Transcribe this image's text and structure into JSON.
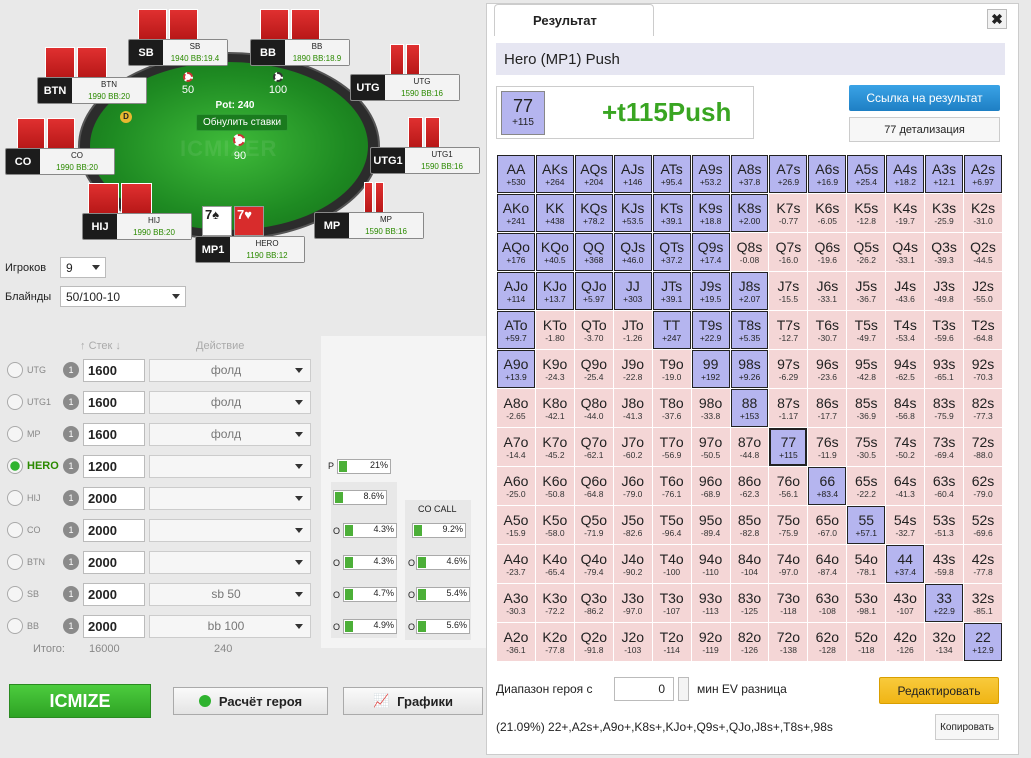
{
  "table": {
    "pot_label": "Pot: 240",
    "reset_label": "Обнулить ставки",
    "watermark": "ICMIZER",
    "bet_sb": "50",
    "bet_bb": "100",
    "hero_bet": "90",
    "seats": [
      {
        "pos": "SB",
        "name": "SB",
        "stack": "1940",
        "bb": "19.4"
      },
      {
        "pos": "BB",
        "name": "BB",
        "stack": "1890",
        "bb": "18.9"
      },
      {
        "pos": "UTG",
        "name": "UTG",
        "stack": "1590",
        "bb": "16"
      },
      {
        "pos": "UTG1",
        "name": "UTG1",
        "stack": "1590",
        "bb": "16"
      },
      {
        "pos": "MP",
        "name": "MP",
        "stack": "1590",
        "bb": "16"
      },
      {
        "pos": "MP1",
        "name": "HERO",
        "stack": "1190",
        "bb": "12"
      },
      {
        "pos": "HIJ",
        "name": "HIJ",
        "stack": "1990",
        "bb": "20"
      },
      {
        "pos": "CO",
        "name": "CO",
        "stack": "1990",
        "bb": "20"
      },
      {
        "pos": "BTN",
        "name": "BTN",
        "stack": "1990",
        "bb": "20"
      }
    ],
    "hero_cards": [
      "7♠",
      "7♥"
    ],
    "bb_suffix": "BB:",
    "dealer": "D"
  },
  "settings": {
    "players_label": "Игроков",
    "players_value": "9",
    "blinds_label": "Блайнды",
    "blinds_value": "50/100-10"
  },
  "players_table": {
    "stack_header": "Стек",
    "action_header": "Действие",
    "total_label": "Итого:",
    "total_stack": "16000",
    "total_action": "240",
    "rows": [
      {
        "name": "UTG",
        "stack": "1600",
        "action": "фолд",
        "on": false
      },
      {
        "name": "UTG1",
        "stack": "1600",
        "action": "фолд",
        "on": false
      },
      {
        "name": "MP",
        "stack": "1600",
        "action": "фолд",
        "on": false
      },
      {
        "name": "HERO",
        "stack": "1200",
        "action": "",
        "on": true
      },
      {
        "name": "HIJ",
        "stack": "2000",
        "action": "",
        "on": false
      },
      {
        "name": "CO",
        "stack": "2000",
        "action": "",
        "on": false
      },
      {
        "name": "BTN",
        "stack": "2000",
        "action": "",
        "on": false
      },
      {
        "name": "SB",
        "stack": "2000",
        "action": "sb 50",
        "on": false
      },
      {
        "name": "BB",
        "stack": "2000",
        "action": "bb 100",
        "on": false
      }
    ],
    "badge": "1"
  },
  "mini": {
    "p_label": "P",
    "p_value": "21%",
    "col1": [
      "8.6%",
      "4.3%",
      "4.3%",
      "4.7%",
      "4.9%"
    ],
    "col1_label": "O",
    "col2_header": "CO CALL",
    "col2": [
      "9.2%",
      "4.6%",
      "5.4%",
      "5.6%"
    ],
    "col2_label": "O"
  },
  "buttons": {
    "icmize": "ICMIZE",
    "hero_calc": "Расчёт героя",
    "graphs": "Графики"
  },
  "result": {
    "tab_title": "Результат",
    "close": "✖",
    "header": "Hero (MP1) Push",
    "hand": "77",
    "hand_ev": "+115",
    "ev_text": "+t115Push",
    "link_btn": "Ссылка на результат",
    "detail_btn": "77 детализация",
    "range_label": "Диапазон героя с",
    "range_value": "0",
    "min_ev_label": "мин EV разница",
    "edit_btn": "Редактировать",
    "summary": "(21.09%) 22+,A2s+,A9o+,K8s+,KJo+,Q9s+,QJo,J8s+,T8s+,98s",
    "copy_btn": "Копировать"
  },
  "chart_data": {
    "type": "table",
    "rows": [
      [
        [
          "AA",
          "+530",
          1
        ],
        [
          "AKs",
          "+264",
          1
        ],
        [
          "AQs",
          "+204",
          1
        ],
        [
          "AJs",
          "+146",
          1
        ],
        [
          "ATs",
          "+95.4",
          1
        ],
        [
          "A9s",
          "+53.2",
          1
        ],
        [
          "A8s",
          "+37.8",
          1
        ],
        [
          "A7s",
          "+26.9",
          1
        ],
        [
          "A6s",
          "+16.9",
          1
        ],
        [
          "A5s",
          "+25.4",
          1
        ],
        [
          "A4s",
          "+18.2",
          1
        ],
        [
          "A3s",
          "+12.1",
          1
        ],
        [
          "A2s",
          "+6.97",
          1
        ]
      ],
      [
        [
          "AKo",
          "+241",
          1
        ],
        [
          "KK",
          "+438",
          1
        ],
        [
          "KQs",
          "+78.2",
          1
        ],
        [
          "KJs",
          "+53.5",
          1
        ],
        [
          "KTs",
          "+39.1",
          1
        ],
        [
          "K9s",
          "+18.8",
          1
        ],
        [
          "K8s",
          "+2.00",
          1
        ],
        [
          "K7s",
          "-0.77",
          0
        ],
        [
          "K6s",
          "-6.05",
          0
        ],
        [
          "K5s",
          "-12.8",
          0
        ],
        [
          "K4s",
          "-19.7",
          0
        ],
        [
          "K3s",
          "-25.9",
          0
        ],
        [
          "K2s",
          "-31.0",
          0
        ]
      ],
      [
        [
          "AQo",
          "+176",
          1
        ],
        [
          "KQo",
          "+40.5",
          1
        ],
        [
          "QQ",
          "+368",
          1
        ],
        [
          "QJs",
          "+46.0",
          1
        ],
        [
          "QTs",
          "+37.2",
          1
        ],
        [
          "Q9s",
          "+17.4",
          1
        ],
        [
          "Q8s",
          "-0.08",
          0
        ],
        [
          "Q7s",
          "-16.0",
          0
        ],
        [
          "Q6s",
          "-19.6",
          0
        ],
        [
          "Q5s",
          "-26.2",
          0
        ],
        [
          "Q4s",
          "-33.1",
          0
        ],
        [
          "Q3s",
          "-39.3",
          0
        ],
        [
          "Q2s",
          "-44.5",
          0
        ]
      ],
      [
        [
          "AJo",
          "+114",
          1
        ],
        [
          "KJo",
          "+13.7",
          1
        ],
        [
          "QJo",
          "+5.97",
          1
        ],
        [
          "JJ",
          "+303",
          1
        ],
        [
          "JTs",
          "+39.1",
          1
        ],
        [
          "J9s",
          "+19.5",
          1
        ],
        [
          "J8s",
          "+2.07",
          1
        ],
        [
          "J7s",
          "-15.5",
          0
        ],
        [
          "J6s",
          "-33.1",
          0
        ],
        [
          "J5s",
          "-36.7",
          0
        ],
        [
          "J4s",
          "-43.6",
          0
        ],
        [
          "J3s",
          "-49.8",
          0
        ],
        [
          "J2s",
          "-55.0",
          0
        ]
      ],
      [
        [
          "ATo",
          "+59.7",
          1
        ],
        [
          "KTo",
          "-1.80",
          0
        ],
        [
          "QTo",
          "-3.70",
          0
        ],
        [
          "JTo",
          "-1.26",
          0
        ],
        [
          "TT",
          "+247",
          1
        ],
        [
          "T9s",
          "+22.9",
          1
        ],
        [
          "T8s",
          "+5.35",
          1
        ],
        [
          "T7s",
          "-12.7",
          0
        ],
        [
          "T6s",
          "-30.7",
          0
        ],
        [
          "T5s",
          "-49.7",
          0
        ],
        [
          "T4s",
          "-53.4",
          0
        ],
        [
          "T3s",
          "-59.6",
          0
        ],
        [
          "T2s",
          "-64.8",
          0
        ]
      ],
      [
        [
          "A9o",
          "+13.9",
          1
        ],
        [
          "K9o",
          "-24.3",
          0
        ],
        [
          "Q9o",
          "-25.4",
          0
        ],
        [
          "J9o",
          "-22.8",
          0
        ],
        [
          "T9o",
          "-19.0",
          0
        ],
        [
          "99",
          "+192",
          1
        ],
        [
          "98s",
          "+9.26",
          1
        ],
        [
          "97s",
          "-6.29",
          0
        ],
        [
          "96s",
          "-23.6",
          0
        ],
        [
          "95s",
          "-42.8",
          0
        ],
        [
          "94s",
          "-62.5",
          0
        ],
        [
          "93s",
          "-65.1",
          0
        ],
        [
          "92s",
          "-70.3",
          0
        ]
      ],
      [
        [
          "A8o",
          "-2.65",
          0
        ],
        [
          "K8o",
          "-42.1",
          0
        ],
        [
          "Q8o",
          "-44.0",
          0
        ],
        [
          "J8o",
          "-41.3",
          0
        ],
        [
          "T8o",
          "-37.6",
          0
        ],
        [
          "98o",
          "-33.8",
          0
        ],
        [
          "88",
          "+153",
          1
        ],
        [
          "87s",
          "-1.17",
          0
        ],
        [
          "86s",
          "-17.7",
          0
        ],
        [
          "85s",
          "-36.9",
          0
        ],
        [
          "84s",
          "-56.8",
          0
        ],
        [
          "83s",
          "-75.9",
          0
        ],
        [
          "82s",
          "-77.3",
          0
        ]
      ],
      [
        [
          "A7o",
          "-14.4",
          0
        ],
        [
          "K7o",
          "-45.2",
          0
        ],
        [
          "Q7o",
          "-62.1",
          0
        ],
        [
          "J7o",
          "-60.2",
          0
        ],
        [
          "T7o",
          "-56.9",
          0
        ],
        [
          "97o",
          "-50.5",
          0
        ],
        [
          "87o",
          "-44.8",
          0
        ],
        [
          "77",
          "+115",
          2
        ],
        [
          "76s",
          "-11.9",
          0
        ],
        [
          "75s",
          "-30.5",
          0
        ],
        [
          "74s",
          "-50.2",
          0
        ],
        [
          "73s",
          "-69.4",
          0
        ],
        [
          "72s",
          "-88.0",
          0
        ]
      ],
      [
        [
          "A6o",
          "-25.0",
          0
        ],
        [
          "K6o",
          "-50.8",
          0
        ],
        [
          "Q6o",
          "-64.8",
          0
        ],
        [
          "J6o",
          "-79.0",
          0
        ],
        [
          "T6o",
          "-76.1",
          0
        ],
        [
          "96o",
          "-68.9",
          0
        ],
        [
          "86o",
          "-62.3",
          0
        ],
        [
          "76o",
          "-56.1",
          0
        ],
        [
          "66",
          "+83.4",
          1
        ],
        [
          "65s",
          "-22.2",
          0
        ],
        [
          "64s",
          "-41.3",
          0
        ],
        [
          "63s",
          "-60.4",
          0
        ],
        [
          "62s",
          "-79.0",
          0
        ]
      ],
      [
        [
          "A5o",
          "-15.9",
          0
        ],
        [
          "K5o",
          "-58.0",
          0
        ],
        [
          "Q5o",
          "-71.9",
          0
        ],
        [
          "J5o",
          "-82.6",
          0
        ],
        [
          "T5o",
          "-96.4",
          0
        ],
        [
          "95o",
          "-89.4",
          0
        ],
        [
          "85o",
          "-82.8",
          0
        ],
        [
          "75o",
          "-75.9",
          0
        ],
        [
          "65o",
          "-67.0",
          0
        ],
        [
          "55",
          "+57.1",
          1
        ],
        [
          "54s",
          "-32.7",
          0
        ],
        [
          "53s",
          "-51.3",
          0
        ],
        [
          "52s",
          "-69.6",
          0
        ]
      ],
      [
        [
          "A4o",
          "-23.7",
          0
        ],
        [
          "K4o",
          "-65.4",
          0
        ],
        [
          "Q4o",
          "-79.4",
          0
        ],
        [
          "J4o",
          "-90.2",
          0
        ],
        [
          "T4o",
          "-100",
          0
        ],
        [
          "94o",
          "-110",
          0
        ],
        [
          "84o",
          "-104",
          0
        ],
        [
          "74o",
          "-97.0",
          0
        ],
        [
          "64o",
          "-87.4",
          0
        ],
        [
          "54o",
          "-78.1",
          0
        ],
        [
          "44",
          "+37.4",
          1
        ],
        [
          "43s",
          "-59.8",
          0
        ],
        [
          "42s",
          "-77.8",
          0
        ]
      ],
      [
        [
          "A3o",
          "-30.3",
          0
        ],
        [
          "K3o",
          "-72.2",
          0
        ],
        [
          "Q3o",
          "-86.2",
          0
        ],
        [
          "J3o",
          "-97.0",
          0
        ],
        [
          "T3o",
          "-107",
          0
        ],
        [
          "93o",
          "-113",
          0
        ],
        [
          "83o",
          "-125",
          0
        ],
        [
          "73o",
          "-118",
          0
        ],
        [
          "63o",
          "-108",
          0
        ],
        [
          "53o",
          "-98.1",
          0
        ],
        [
          "43o",
          "-107",
          0
        ],
        [
          "33",
          "+22.9",
          1
        ],
        [
          "32s",
          "-85.1",
          0
        ]
      ],
      [
        [
          "A2o",
          "-36.1",
          0
        ],
        [
          "K2o",
          "-77.8",
          0
        ],
        [
          "Q2o",
          "-91.8",
          0
        ],
        [
          "J2o",
          "-103",
          0
        ],
        [
          "T2o",
          "-114",
          0
        ],
        [
          "92o",
          "-119",
          0
        ],
        [
          "82o",
          "-126",
          0
        ],
        [
          "72o",
          "-138",
          0
        ],
        [
          "62o",
          "-128",
          0
        ],
        [
          "52o",
          "-118",
          0
        ],
        [
          "42o",
          "-126",
          0
        ],
        [
          "32o",
          "-134",
          0
        ],
        [
          "22",
          "+12.9",
          1
        ]
      ]
    ]
  }
}
